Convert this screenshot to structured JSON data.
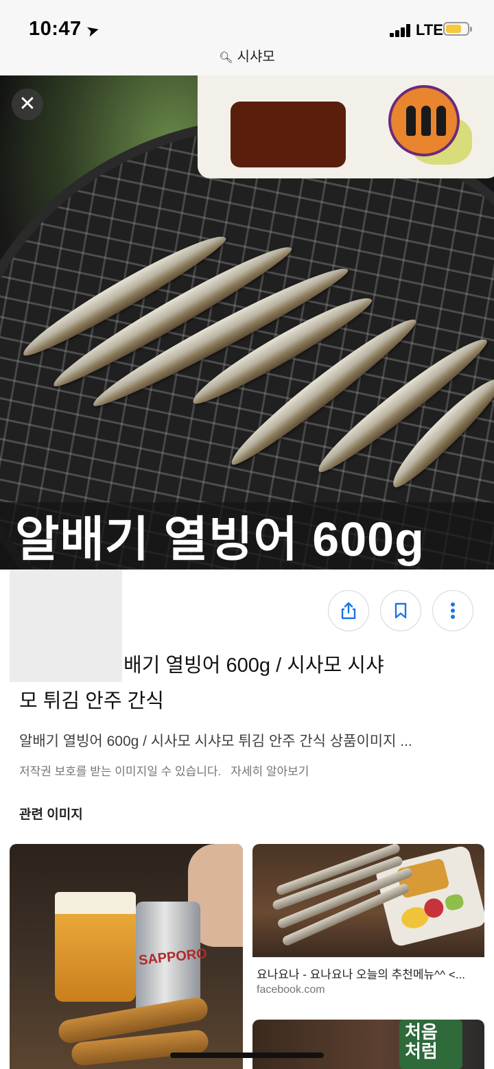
{
  "status_bar": {
    "time": "10:47",
    "network": "LTE",
    "battery_color": "#f5c93c"
  },
  "search": {
    "query": "시샤모"
  },
  "hero": {
    "caption": "알배기 열빙어 600g",
    "close_icon": "close-icon"
  },
  "actions": [
    {
      "name": "share",
      "icon": "share-icon"
    },
    {
      "name": "bookmark",
      "icon": "bookmark-icon"
    },
    {
      "name": "more",
      "icon": "more-vert-icon"
    }
  ],
  "result": {
    "title_line1": "배기 열빙어 600g / 시사모 시샤",
    "title_line2": "모 튀김 안주 간식",
    "description": "알배기 열빙어 600g / 시사모 시샤모 튀김 안주 간식 상품이미지 ...",
    "copyright_notice": "저작권 보호를 받는 이미지일 수 있습니다.",
    "learn_more": "자세히 알아보기"
  },
  "related": {
    "heading": "관련 이미지",
    "items": [
      {
        "caption": "",
        "source": "",
        "label": "SAPPORO"
      },
      {
        "caption": "요나요나 - 요나요나 오늘의 추천메뉴^^ <...",
        "source": "facebook.com"
      },
      {
        "caption": "",
        "source": "",
        "label": "처음\n처럼"
      }
    ]
  },
  "colors": {
    "icon_blue": "#1a73e8",
    "muted": "#70757a"
  }
}
